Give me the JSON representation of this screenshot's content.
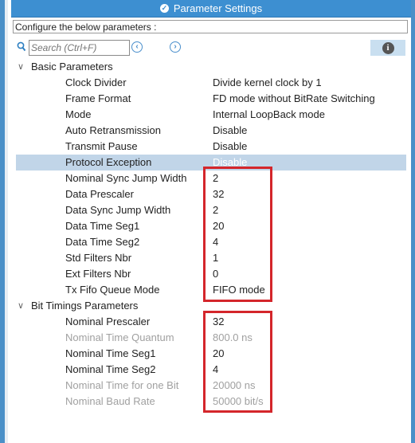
{
  "title": "Parameter Settings",
  "configure_text": "Configure the below parameters :",
  "search_placeholder": "Search (Ctrl+F)",
  "groups": [
    {
      "label": "Basic Parameters",
      "rows": [
        {
          "name": "Clock Divider",
          "value": "Divide kernel clock by 1"
        },
        {
          "name": "Frame Format",
          "value": "FD mode without BitRate Switching"
        },
        {
          "name": "Mode",
          "value": "Internal LoopBack mode"
        },
        {
          "name": "Auto Retransmission",
          "value": "Disable"
        },
        {
          "name": "Transmit Pause",
          "value": "Disable"
        },
        {
          "name": "Protocol Exception",
          "value": "Disable",
          "selected": true
        },
        {
          "name": "Nominal Sync Jump Width",
          "value": "2"
        },
        {
          "name": "Data Prescaler",
          "value": "32"
        },
        {
          "name": "Data Sync Jump Width",
          "value": "2"
        },
        {
          "name": "Data Time Seg1",
          "value": "20"
        },
        {
          "name": "Data Time Seg2",
          "value": "4"
        },
        {
          "name": "Std Filters Nbr",
          "value": "1"
        },
        {
          "name": "Ext Filters Nbr",
          "value": "0"
        },
        {
          "name": "Tx Fifo Queue Mode",
          "value": "FIFO mode"
        }
      ]
    },
    {
      "label": "Bit Timings Parameters",
      "rows": [
        {
          "name": "Nominal Prescaler",
          "value": "32"
        },
        {
          "name": "Nominal Time Quantum",
          "value": "800.0 ns",
          "disabled": true
        },
        {
          "name": "Nominal Time Seg1",
          "value": "20"
        },
        {
          "name": "Nominal Time Seg2",
          "value": "4"
        },
        {
          "name": "Nominal Time for one Bit",
          "value": "20000 ns",
          "disabled": true
        },
        {
          "name": "Nominal Baud Rate",
          "value": "50000 bit/s",
          "disabled": true
        }
      ]
    }
  ],
  "colors": {
    "accent": "#3d8fd1",
    "highlight_box": "#d4262b",
    "selected_row": "#c1d5e8"
  }
}
